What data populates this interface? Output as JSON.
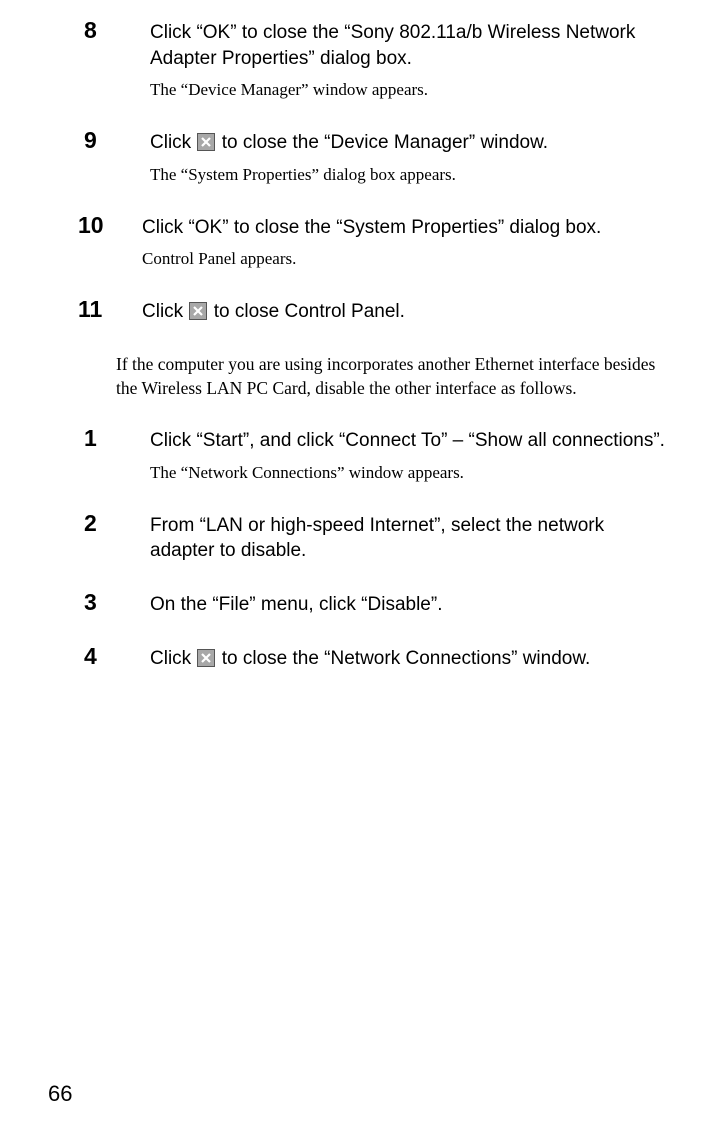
{
  "page_number": "66",
  "steps_a": [
    {
      "num": "8",
      "main": "Click “OK” to close the “Sony 802.11a/b Wireless Network Adapter Properties” dialog box.",
      "sub": "The “Device Manager” window appears.",
      "icon": false
    },
    {
      "num": "9",
      "main_pre": "Click ",
      "main_post": " to close the “Device Manager” window.",
      "sub": "The “System Properties” dialog box appears.",
      "icon": true
    },
    {
      "num": "10",
      "main": "Click “OK” to close the “System Properties” dialog box.",
      "sub": "Control Panel appears.",
      "icon": false
    },
    {
      "num": "11",
      "main_pre": "Click ",
      "main_post": " to close Control Panel.",
      "icon": true
    }
  ],
  "paragraph": "If the computer you are using incorporates another Ethernet interface besides the Wireless LAN PC Card, disable the other interface as follows.",
  "steps_b": [
    {
      "num": "1",
      "main": "Click “Start”, and click “Connect To” – “Show all connections”.",
      "sub": "The “Network Connections” window appears.",
      "icon": false
    },
    {
      "num": "2",
      "main": "From “LAN or high-speed Internet”, select the network adapter to disable.",
      "icon": false
    },
    {
      "num": "3",
      "main": "On the “File” menu, click “Disable”.",
      "icon": false
    },
    {
      "num": "4",
      "main_pre": "Click ",
      "main_post": " to close the “Network Connections” window.",
      "icon": true
    }
  ]
}
